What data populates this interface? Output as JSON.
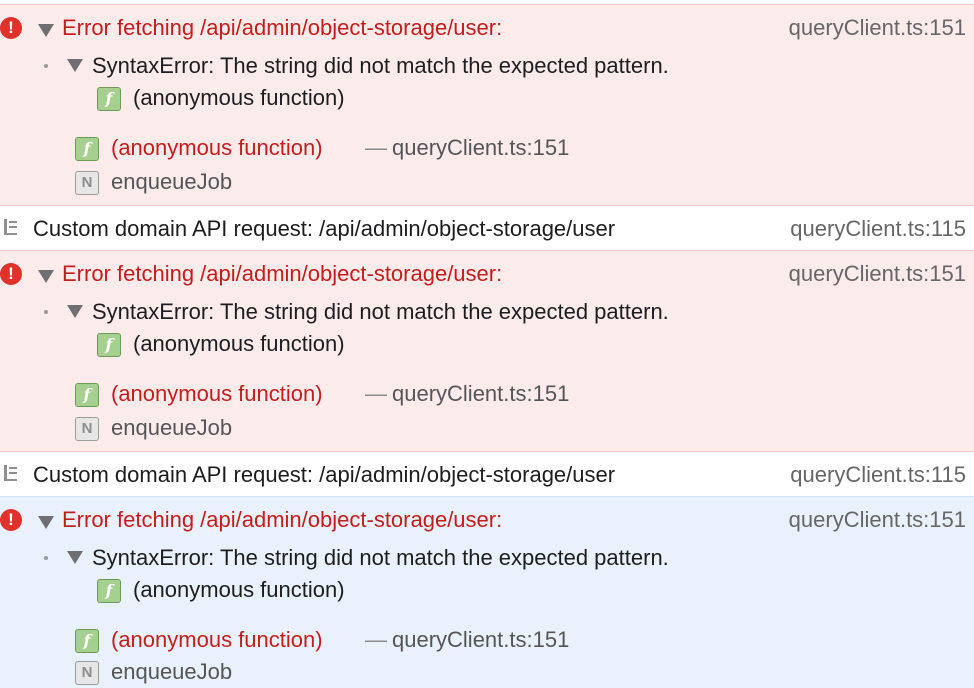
{
  "colors": {
    "error_bg": "#fcebeb",
    "selected_bg": "#e9f2fc",
    "error_text": "#c41d1d",
    "badge_green": "#a6d08f"
  },
  "icons": [
    "error-icon",
    "disclosure-triangle-icon",
    "function-icon",
    "native-code-icon",
    "log-icon"
  ],
  "entries": [
    {
      "type": "error",
      "message": "Error fetching /api/admin/object-storage/user:",
      "source": "queryClient.ts:151",
      "exception": "SyntaxError: The string did not match the expected pattern.",
      "exception_frame": "(anonymous function)",
      "stack": [
        {
          "badge": "f",
          "name": "(anonymous function)",
          "separator": "—",
          "location": "queryClient.ts:151"
        },
        {
          "badge": "N",
          "name": "enqueueJob"
        }
      ]
    },
    {
      "type": "log",
      "message": "Custom domain API request: /api/admin/object-storage/user",
      "source": "queryClient.ts:115"
    },
    {
      "type": "error",
      "message": "Error fetching /api/admin/object-storage/user:",
      "source": "queryClient.ts:151",
      "exception": "SyntaxError: The string did not match the expected pattern.",
      "exception_frame": "(anonymous function)",
      "stack": [
        {
          "badge": "f",
          "name": "(anonymous function)",
          "separator": "—",
          "location": "queryClient.ts:151"
        },
        {
          "badge": "N",
          "name": "enqueueJob"
        }
      ]
    },
    {
      "type": "log",
      "message": "Custom domain API request: /api/admin/object-storage/user",
      "source": "queryClient.ts:115"
    },
    {
      "type": "error",
      "selected": true,
      "message": "Error fetching /api/admin/object-storage/user:",
      "source": "queryClient.ts:151",
      "exception": "SyntaxError: The string did not match the expected pattern.",
      "exception_frame": "(anonymous function)",
      "stack": [
        {
          "badge": "f",
          "name": "(anonymous function)",
          "separator": "—",
          "location": "queryClient.ts:151"
        },
        {
          "badge": "N",
          "name": "enqueueJob"
        }
      ]
    }
  ]
}
